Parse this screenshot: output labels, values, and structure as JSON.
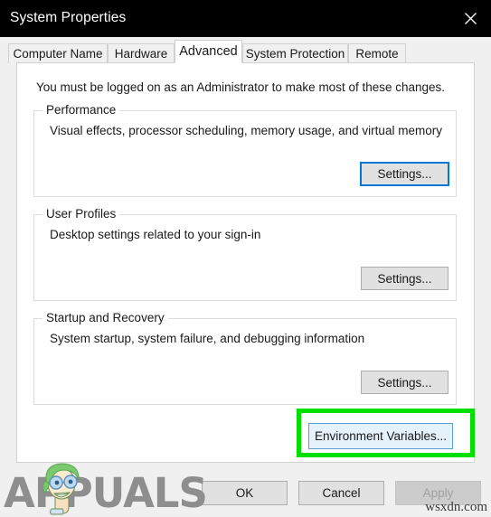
{
  "window": {
    "title": "System Properties",
    "close_icon": "close-icon"
  },
  "tabs": [
    {
      "label": "Computer Name",
      "active": false
    },
    {
      "label": "Hardware",
      "active": false
    },
    {
      "label": "Advanced",
      "active": true
    },
    {
      "label": "System Protection",
      "active": false
    },
    {
      "label": "Remote",
      "active": false
    }
  ],
  "content": {
    "admin_note": "You must be logged on as an Administrator to make most of these changes.",
    "groups": [
      {
        "legend": "Performance",
        "description": "Visual effects, processor scheduling, memory usage, and virtual memory",
        "button_label": "Settings...",
        "button_state": "focused"
      },
      {
        "legend": "User Profiles",
        "description": "Desktop settings related to your sign-in",
        "button_label": "Settings...",
        "button_state": "normal"
      },
      {
        "legend": "Startup and Recovery",
        "description": "System startup, system failure, and debugging information",
        "button_label": "Settings...",
        "button_state": "normal"
      }
    ],
    "environment_variables_button": {
      "label": "Environment Variables...",
      "state": "hover",
      "highlight_color": "#00e000"
    }
  },
  "footer": {
    "ok_label": "OK",
    "cancel_label": "Cancel",
    "apply_label": "Apply",
    "apply_disabled": true
  },
  "watermarks": {
    "brand": "APPUALS",
    "site": "wsxdn.com"
  }
}
